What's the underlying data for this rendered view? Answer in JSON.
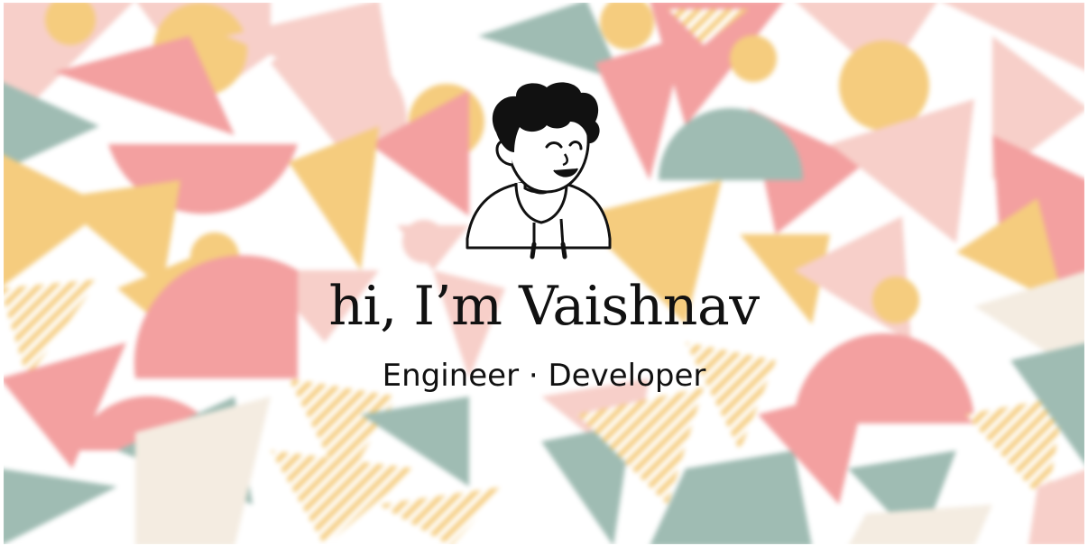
{
  "hero": {
    "greeting": "hi, I’m Vaishnav",
    "tagline": "Engineer · Developer",
    "avatar_icon": "cartoon-avatar-winking",
    "background_icon": "geometric-pattern"
  },
  "colors": {
    "coral": "#f3a0a0",
    "pink": "#f7cfc9",
    "mustard": "#f5cc7e",
    "sage": "#9fbcb3",
    "cream": "#f4ece1",
    "text": "#111111"
  }
}
